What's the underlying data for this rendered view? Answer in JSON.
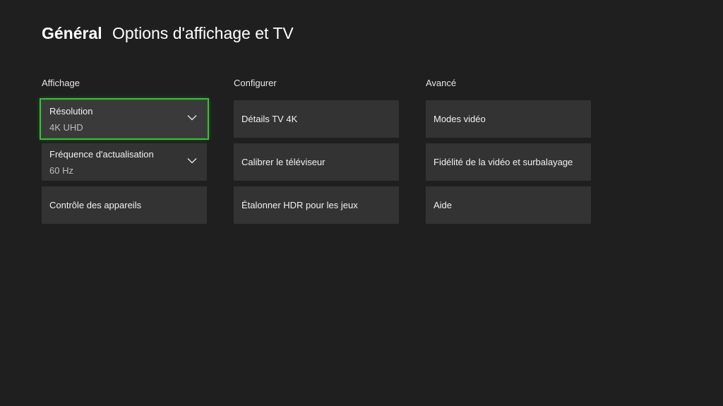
{
  "header": {
    "section": "Général",
    "title": "Options d'affichage et TV"
  },
  "columns": [
    {
      "heading": "Affichage",
      "tiles": [
        {
          "label": "Résolution",
          "value": "4K UHD",
          "icon": "chevron-down-icon",
          "focused": true
        },
        {
          "label": "Fréquence d'actualisation",
          "value": "60 Hz",
          "icon": "chevron-down-icon"
        },
        {
          "label": "Contrôle des appareils"
        }
      ]
    },
    {
      "heading": "Configurer",
      "tiles": [
        {
          "label": "Détails TV 4K"
        },
        {
          "label": "Calibrer le téléviseur"
        },
        {
          "label": "Étalonner HDR pour les jeux"
        }
      ]
    },
    {
      "heading": "Avancé",
      "tiles": [
        {
          "label": "Modes vidéo"
        },
        {
          "label": "Fidélité de la vidéo et surbalayage"
        },
        {
          "label": "Aide"
        }
      ]
    }
  ],
  "colors": {
    "background": "#1f1f1f",
    "tile": "#333333",
    "focus": "#3bbf3b"
  }
}
